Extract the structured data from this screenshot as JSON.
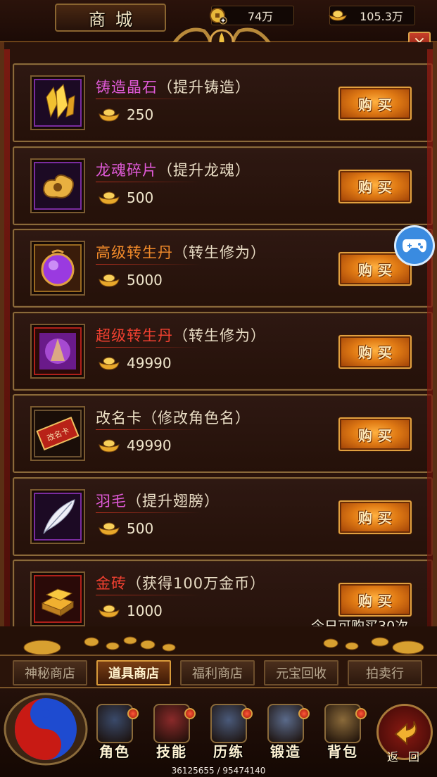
{
  "header": {
    "title": "商城",
    "coin_value": "74万",
    "ingot_value": "105.3万",
    "close_icon": "close-icon"
  },
  "items": [
    {
      "name": "铸造晶石",
      "desc": "（提升铸造）",
      "name_color": "#e05ad8",
      "price": "250",
      "buy_label": "购买",
      "icon": "yellow-crystal-icon"
    },
    {
      "name": "龙魂碎片",
      "desc": "（提升龙魂）",
      "name_color": "#e05ad8",
      "price": "500",
      "buy_label": "购买",
      "icon": "golden-cloud-icon"
    },
    {
      "name": "高级转生丹",
      "desc": "（转生修为）",
      "name_color": "#f08a2a",
      "price": "5000",
      "buy_label": "购买",
      "icon": "purple-orb-icon"
    },
    {
      "name": "超级转生丹",
      "desc": "（转生修为）",
      "name_color": "#f04030",
      "price": "49990",
      "buy_label": "购买",
      "icon": "super-pill-icon"
    },
    {
      "name": "改名卡",
      "desc": "（修改角色名）",
      "name_color": "#f0e4c8",
      "price": "49990",
      "buy_label": "购买",
      "icon": "rename-card-icon",
      "card_text": "改名卡"
    },
    {
      "name": "羽毛",
      "desc": "（提升翅膀）",
      "name_color": "#e05ad8",
      "price": "500",
      "buy_label": "购买",
      "icon": "white-feather-icon"
    },
    {
      "name": "金砖",
      "desc": "（获得100万金币）",
      "name_color": "#f04030",
      "price": "1000",
      "buy_label": "购买",
      "icon": "gold-bar-icon"
    }
  ],
  "daily_limit": "今日可购买30次",
  "tabs": [
    {
      "label": "神秘商店",
      "active": false
    },
    {
      "label": "道具商店",
      "active": true
    },
    {
      "label": "福利商店",
      "active": false
    },
    {
      "label": "元宝回收",
      "active": false
    },
    {
      "label": "拍卖行",
      "active": false
    }
  ],
  "nav": [
    {
      "label": "角色",
      "icon": "character-portrait-icon"
    },
    {
      "label": "技能",
      "icon": "skill-portrait-icon"
    },
    {
      "label": "历练",
      "icon": "training-portrait-icon"
    },
    {
      "label": "锻造",
      "icon": "forge-portrait-icon"
    },
    {
      "label": "背包",
      "icon": "bag-portrait-icon"
    }
  ],
  "return_label": "返回",
  "exp_text": "36125655 / 95474140",
  "colors": {
    "accent_gold": "#d89a3a",
    "button_orange": "#e07a14",
    "panel_bg": "#2a130b"
  }
}
